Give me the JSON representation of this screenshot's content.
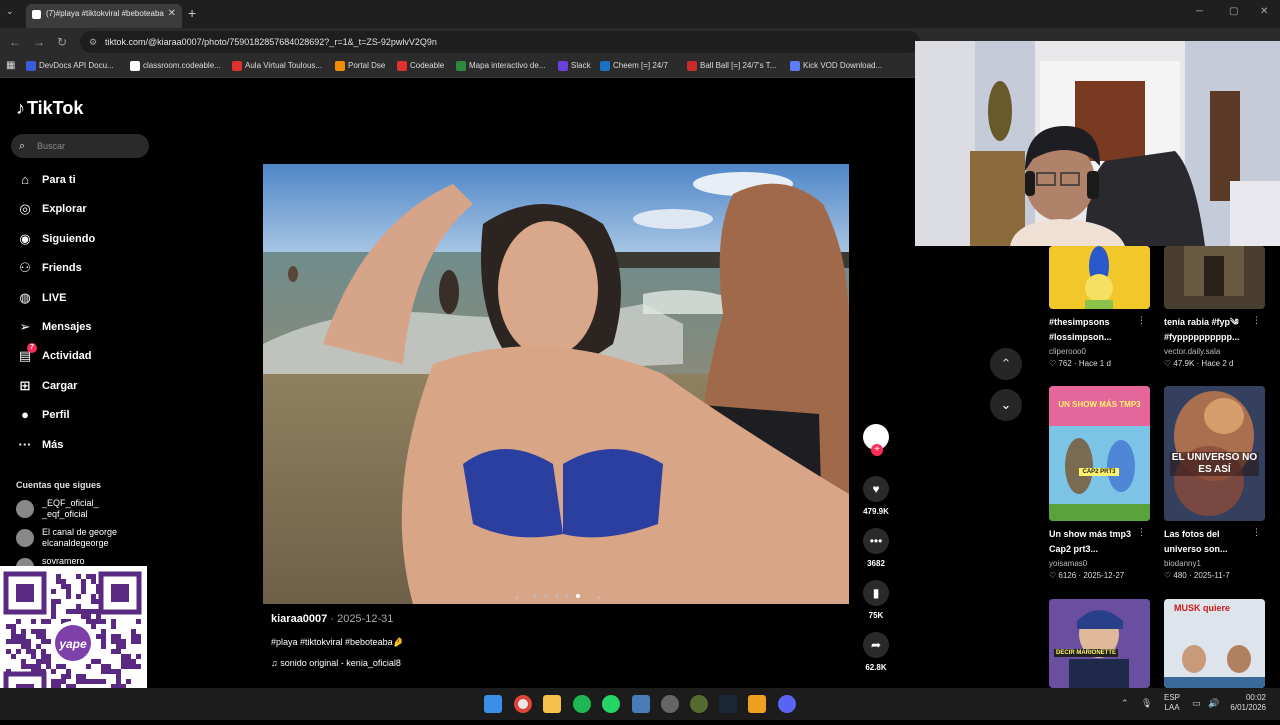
{
  "browser": {
    "tab_title": "(7)#playa #tiktokviral #beboteaba",
    "url": "tiktok.com/@kiaraa0007/photo/7590182857684028692?_r=1&_t=ZS-92pwlvV2Q9n",
    "bookmarks": [
      "DevDocs API Docu...",
      "classroom.codeable...",
      "Aula Virtual Toulous...",
      "Portal Dse",
      "Codeable",
      "Mapa interactivo de...",
      "Slack",
      "Cheem [=] 24/7",
      "Ball Ball [=] 24/7's T...",
      "Kick VOD Download..."
    ],
    "bookmark_colors": [
      "#3b5bdb",
      "#ffffff",
      "#e03131",
      "#f08c00",
      "#e03131",
      "#2b8a3e",
      "#6741d9",
      "#1971c2",
      "#c92a2a",
      "#5c7cfa"
    ]
  },
  "sidebar": {
    "brand": "TikTok",
    "search_placeholder": "Buscar",
    "nav": [
      {
        "label": "Para ti",
        "icon": "home-icon"
      },
      {
        "label": "Explorar",
        "icon": "compass-icon"
      },
      {
        "label": "Siguiendo",
        "icon": "following-icon"
      },
      {
        "label": "Friends",
        "icon": "friends-icon"
      },
      {
        "label": "LIVE",
        "icon": "live-icon"
      },
      {
        "label": "Mensajes",
        "icon": "send-icon"
      },
      {
        "label": "Actividad",
        "icon": "activity-icon",
        "badge": "7"
      },
      {
        "label": "Cargar",
        "icon": "upload-icon"
      },
      {
        "label": "Perfil",
        "icon": "profile-icon"
      },
      {
        "label": "Más",
        "icon": "more-icon"
      }
    ],
    "following_heading": "Cuentas que sigues",
    "following": [
      {
        "name": "_EQF_oficial_",
        "handle": "_eqf_oficial"
      },
      {
        "name": "El canal de george",
        "handle": "elcanaldegeorge"
      },
      {
        "name": "sovramero",
        "handle": ""
      }
    ]
  },
  "post": {
    "author": "kiaraa0007",
    "date": "2025-12-31",
    "caption": "#playa #tiktokviral #beboteaba🤌",
    "sound": "sonido original - kenia_oficial8",
    "likes": "479.9K",
    "comments": "3682",
    "saves": "75K",
    "shares": "62.8K",
    "accent": "#fe2c55"
  },
  "grid": [
    {
      "title": "#thesimpsons #lossimpson...",
      "user": "cliperooo0",
      "likes": "762",
      "date": "Hace 1 d"
    },
    {
      "title": "tenía rabia #fyp༄ #fypppppppppp...",
      "user": "vector.daily.sala",
      "likes": "47.9K",
      "date": "Hace 2 d"
    },
    {
      "title": "Un show más tmp3 Cap2 prt3...",
      "user": "yoisamas0",
      "likes": "6126",
      "date": "2025-12-27",
      "thumb_text": "UN SHOW MÁS TMP3",
      "thumb_sub": "CAP2 PRT3"
    },
    {
      "title": "Las fotos del universo son...",
      "user": "biodanny1",
      "likes": "480",
      "date": "2025-11-7",
      "thumb_text": "EL UNIVERSO NO ES ASÍ"
    },
    {
      "thumb_text": "DECIR MARIONETTE"
    },
    {
      "thumb_text": "MUSK quiere"
    }
  ],
  "taskbar": {
    "lang": "ESP",
    "lang2": "LAA",
    "time": "00:02",
    "date": "6/01/2026"
  }
}
